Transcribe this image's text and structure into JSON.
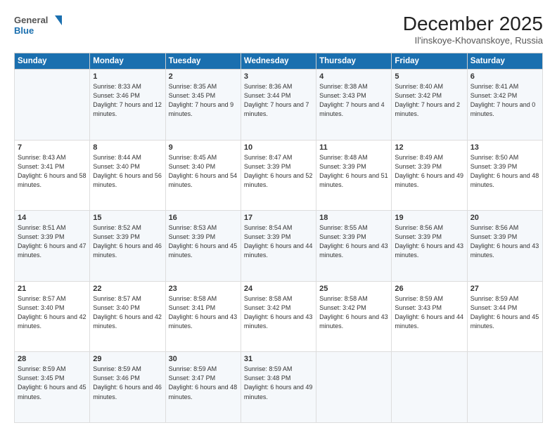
{
  "header": {
    "logo_line1": "General",
    "logo_line2": "Blue",
    "main_title": "December 2025",
    "subtitle": "Il'inskoye-Khovanskoye, Russia"
  },
  "weekdays": [
    "Sunday",
    "Monday",
    "Tuesday",
    "Wednesday",
    "Thursday",
    "Friday",
    "Saturday"
  ],
  "weeks": [
    [
      {
        "day": "",
        "sunrise": "",
        "sunset": "",
        "daylight": ""
      },
      {
        "day": "1",
        "sunrise": "Sunrise: 8:33 AM",
        "sunset": "Sunset: 3:46 PM",
        "daylight": "Daylight: 7 hours and 12 minutes."
      },
      {
        "day": "2",
        "sunrise": "Sunrise: 8:35 AM",
        "sunset": "Sunset: 3:45 PM",
        "daylight": "Daylight: 7 hours and 9 minutes."
      },
      {
        "day": "3",
        "sunrise": "Sunrise: 8:36 AM",
        "sunset": "Sunset: 3:44 PM",
        "daylight": "Daylight: 7 hours and 7 minutes."
      },
      {
        "day": "4",
        "sunrise": "Sunrise: 8:38 AM",
        "sunset": "Sunset: 3:43 PM",
        "daylight": "Daylight: 7 hours and 4 minutes."
      },
      {
        "day": "5",
        "sunrise": "Sunrise: 8:40 AM",
        "sunset": "Sunset: 3:42 PM",
        "daylight": "Daylight: 7 hours and 2 minutes."
      },
      {
        "day": "6",
        "sunrise": "Sunrise: 8:41 AM",
        "sunset": "Sunset: 3:42 PM",
        "daylight": "Daylight: 7 hours and 0 minutes."
      }
    ],
    [
      {
        "day": "7",
        "sunrise": "Sunrise: 8:43 AM",
        "sunset": "Sunset: 3:41 PM",
        "daylight": "Daylight: 6 hours and 58 minutes."
      },
      {
        "day": "8",
        "sunrise": "Sunrise: 8:44 AM",
        "sunset": "Sunset: 3:40 PM",
        "daylight": "Daylight: 6 hours and 56 minutes."
      },
      {
        "day": "9",
        "sunrise": "Sunrise: 8:45 AM",
        "sunset": "Sunset: 3:40 PM",
        "daylight": "Daylight: 6 hours and 54 minutes."
      },
      {
        "day": "10",
        "sunrise": "Sunrise: 8:47 AM",
        "sunset": "Sunset: 3:39 PM",
        "daylight": "Daylight: 6 hours and 52 minutes."
      },
      {
        "day": "11",
        "sunrise": "Sunrise: 8:48 AM",
        "sunset": "Sunset: 3:39 PM",
        "daylight": "Daylight: 6 hours and 51 minutes."
      },
      {
        "day": "12",
        "sunrise": "Sunrise: 8:49 AM",
        "sunset": "Sunset: 3:39 PM",
        "daylight": "Daylight: 6 hours and 49 minutes."
      },
      {
        "day": "13",
        "sunrise": "Sunrise: 8:50 AM",
        "sunset": "Sunset: 3:39 PM",
        "daylight": "Daylight: 6 hours and 48 minutes."
      }
    ],
    [
      {
        "day": "14",
        "sunrise": "Sunrise: 8:51 AM",
        "sunset": "Sunset: 3:39 PM",
        "daylight": "Daylight: 6 hours and 47 minutes."
      },
      {
        "day": "15",
        "sunrise": "Sunrise: 8:52 AM",
        "sunset": "Sunset: 3:39 PM",
        "daylight": "Daylight: 6 hours and 46 minutes."
      },
      {
        "day": "16",
        "sunrise": "Sunrise: 8:53 AM",
        "sunset": "Sunset: 3:39 PM",
        "daylight": "Daylight: 6 hours and 45 minutes."
      },
      {
        "day": "17",
        "sunrise": "Sunrise: 8:54 AM",
        "sunset": "Sunset: 3:39 PM",
        "daylight": "Daylight: 6 hours and 44 minutes."
      },
      {
        "day": "18",
        "sunrise": "Sunrise: 8:55 AM",
        "sunset": "Sunset: 3:39 PM",
        "daylight": "Daylight: 6 hours and 43 minutes."
      },
      {
        "day": "19",
        "sunrise": "Sunrise: 8:56 AM",
        "sunset": "Sunset: 3:39 PM",
        "daylight": "Daylight: 6 hours and 43 minutes."
      },
      {
        "day": "20",
        "sunrise": "Sunrise: 8:56 AM",
        "sunset": "Sunset: 3:39 PM",
        "daylight": "Daylight: 6 hours and 43 minutes."
      }
    ],
    [
      {
        "day": "21",
        "sunrise": "Sunrise: 8:57 AM",
        "sunset": "Sunset: 3:40 PM",
        "daylight": "Daylight: 6 hours and 42 minutes."
      },
      {
        "day": "22",
        "sunrise": "Sunrise: 8:57 AM",
        "sunset": "Sunset: 3:40 PM",
        "daylight": "Daylight: 6 hours and 42 minutes."
      },
      {
        "day": "23",
        "sunrise": "Sunrise: 8:58 AM",
        "sunset": "Sunset: 3:41 PM",
        "daylight": "Daylight: 6 hours and 43 minutes."
      },
      {
        "day": "24",
        "sunrise": "Sunrise: 8:58 AM",
        "sunset": "Sunset: 3:42 PM",
        "daylight": "Daylight: 6 hours and 43 minutes."
      },
      {
        "day": "25",
        "sunrise": "Sunrise: 8:58 AM",
        "sunset": "Sunset: 3:42 PM",
        "daylight": "Daylight: 6 hours and 43 minutes."
      },
      {
        "day": "26",
        "sunrise": "Sunrise: 8:59 AM",
        "sunset": "Sunset: 3:43 PM",
        "daylight": "Daylight: 6 hours and 44 minutes."
      },
      {
        "day": "27",
        "sunrise": "Sunrise: 8:59 AM",
        "sunset": "Sunset: 3:44 PM",
        "daylight": "Daylight: 6 hours and 45 minutes."
      }
    ],
    [
      {
        "day": "28",
        "sunrise": "Sunrise: 8:59 AM",
        "sunset": "Sunset: 3:45 PM",
        "daylight": "Daylight: 6 hours and 45 minutes."
      },
      {
        "day": "29",
        "sunrise": "Sunrise: 8:59 AM",
        "sunset": "Sunset: 3:46 PM",
        "daylight": "Daylight: 6 hours and 46 minutes."
      },
      {
        "day": "30",
        "sunrise": "Sunrise: 8:59 AM",
        "sunset": "Sunset: 3:47 PM",
        "daylight": "Daylight: 6 hours and 48 minutes."
      },
      {
        "day": "31",
        "sunrise": "Sunrise: 8:59 AM",
        "sunset": "Sunset: 3:48 PM",
        "daylight": "Daylight: 6 hours and 49 minutes."
      },
      {
        "day": "",
        "sunrise": "",
        "sunset": "",
        "daylight": ""
      },
      {
        "day": "",
        "sunrise": "",
        "sunset": "",
        "daylight": ""
      },
      {
        "day": "",
        "sunrise": "",
        "sunset": "",
        "daylight": ""
      }
    ]
  ]
}
